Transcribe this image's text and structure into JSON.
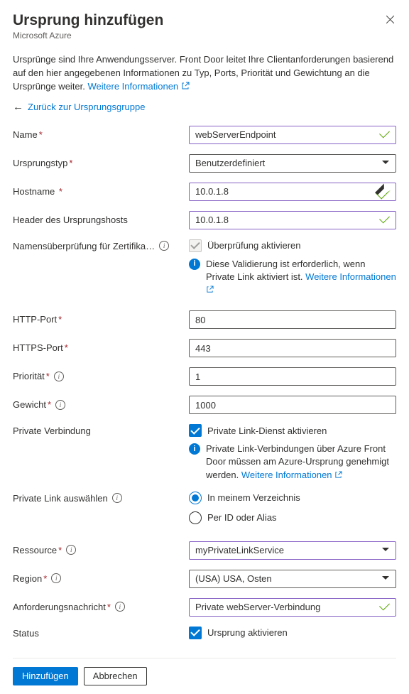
{
  "header": {
    "title": "Ursprung hinzufügen",
    "subtitle": "Microsoft Azure"
  },
  "intro": {
    "text": "Ursprünge sind Ihre Anwendungsserver. Front Door leitet Ihre Clientanforderungen basierend auf den hier angegebenen Informationen zu Typ, Ports, Priorität und Gewichtung an die Ursprünge weiter. ",
    "link": "Weitere Informationen"
  },
  "back_link": "Zurück zur Ursprungsgruppe",
  "fields": {
    "name": {
      "label": "Name",
      "value": "webServerEndpoint"
    },
    "origin_type": {
      "label": "Ursprungstyp",
      "value": "Benutzerdefiniert"
    },
    "hostname": {
      "label": "Hostname",
      "value": "10.0.1.8"
    },
    "host_header": {
      "label": "Header des Ursprungshosts",
      "value": "10.0.1.8"
    },
    "cert_check": {
      "label": "Namensüberprüfung für Zertifika…",
      "checkbox_label": "Überprüfung aktivieren",
      "info": "Diese Validierung ist erforderlich, wenn Private Link aktiviert ist. ",
      "info_link": "Weitere Informationen"
    },
    "http_port": {
      "label": "HTTP-Port",
      "value": "80"
    },
    "https_port": {
      "label": "HTTPS-Port",
      "value": "443"
    },
    "priority": {
      "label": "Priorität",
      "value": "1"
    },
    "weight": {
      "label": "Gewicht",
      "value": "1000"
    },
    "private_link": {
      "label": "Private Verbindung",
      "checkbox_label": "Private Link-Dienst aktivieren",
      "info": "Private Link-Verbindungen über Azure Front Door müssen am Azure-Ursprung genehmigt werden. ",
      "info_link": "Weitere Informationen"
    },
    "pl_select": {
      "label": "Private Link auswählen",
      "option1": "In meinem Verzeichnis",
      "option2": "Per ID oder Alias"
    },
    "resource": {
      "label": "Ressource",
      "value": "myPrivateLinkService"
    },
    "region": {
      "label": "Region",
      "value": "(USA) USA, Osten"
    },
    "request_msg": {
      "label": "Anforderungsnachricht",
      "value": "Private webServer-Verbindung"
    },
    "status": {
      "label": "Status",
      "checkbox_label": "Ursprung aktivieren"
    }
  },
  "buttons": {
    "add": "Hinzufügen",
    "cancel": "Abbrechen"
  }
}
